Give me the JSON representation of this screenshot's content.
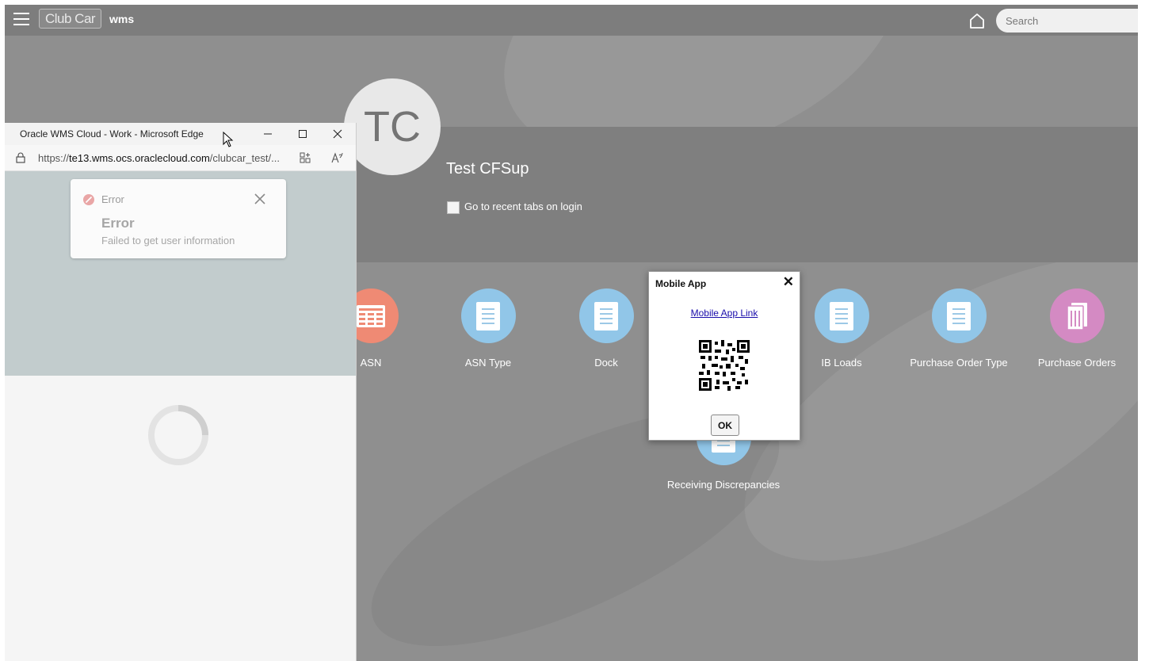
{
  "app": {
    "logo_text": "Club Car",
    "app_name": "wms",
    "search_placeholder": "Search"
  },
  "profile": {
    "initials": "TC",
    "name": "Test CFSup",
    "recent_tabs_label": "Go to recent tabs on login"
  },
  "tiles": [
    {
      "label": "ASN",
      "icon": "table-icon",
      "color": "#ef8a74"
    },
    {
      "label": "ASN Type",
      "icon": "document-icon",
      "color": "#91c6e8"
    },
    {
      "label": "Dock",
      "icon": "document-icon",
      "color": "#91c6e8"
    },
    {
      "label": "IB Loads",
      "icon": "document-icon",
      "color": "#91c6e8"
    },
    {
      "label": "Purchase Order Type",
      "icon": "document-icon",
      "color": "#91c6e8"
    },
    {
      "label": "Purchase Orders",
      "icon": "documents-icon",
      "color": "#d48ac3"
    },
    {
      "label": "Receiving Discrepancies",
      "icon": "document-icon",
      "color": "#91c6e8"
    }
  ],
  "modal": {
    "title": "Mobile App",
    "link_label": "Mobile App Link",
    "ok_label": "OK"
  },
  "browser": {
    "title": "Oracle WMS Cloud - Work - Microsoft Edge",
    "url_prefix": "https://",
    "url_host": "te13.wms.ocs.oraclecloud.com",
    "url_path": "/clubcar_test/..."
  },
  "error_toast": {
    "label": "Error",
    "heading": "Error",
    "message": "Failed to get user information"
  }
}
